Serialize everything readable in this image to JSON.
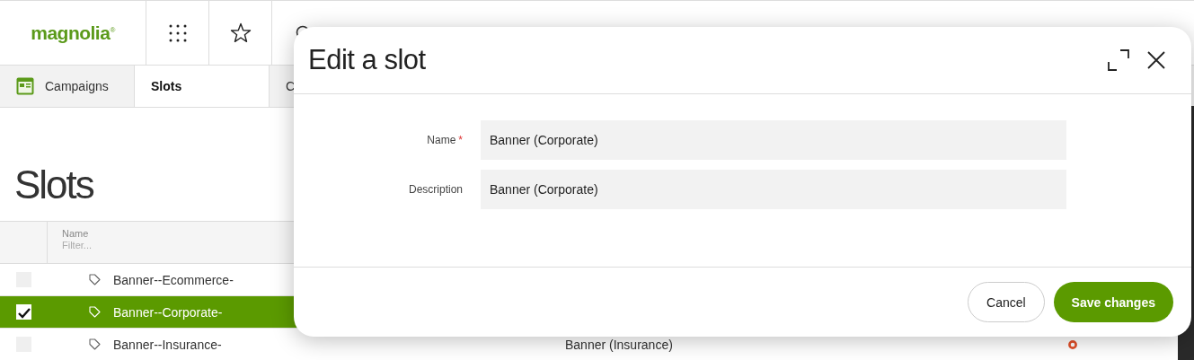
{
  "logo": "magnolia$^{®}$",
  "tabs": [
    {
      "label": "Campaigns",
      "icon": true,
      "selected": false
    },
    {
      "label": "Slots",
      "icon": false,
      "selected": true
    },
    {
      "label": "C",
      "icon": false,
      "selected": false
    }
  ],
  "page_title": "Slots",
  "table": {
    "columns": [
      {
        "label": "Name",
        "filter_placeholder": "Filter..."
      }
    ],
    "rows": [
      {
        "name": "Banner--Ecommerce-",
        "checked": false,
        "selected": false
      },
      {
        "name": "Banner--Corporate-",
        "checked": true,
        "selected": true
      },
      {
        "name": "Banner--Insurance-",
        "checked": false,
        "selected": false,
        "description": "Banner (Insurance)",
        "color": "#e2502a"
      }
    ]
  },
  "dialog": {
    "title": "Edit a slot",
    "fields": [
      {
        "label": "Name",
        "marker": "*",
        "value": "Banner (Corporate)"
      },
      {
        "label": "Description",
        "value": "Banner (Corporate)"
      }
    ],
    "buttons": [
      {
        "label": "Cancel",
        "kind": "secondary"
      },
      {
        "label": "Save changes",
        "kind": "primary"
      }
    ]
  }
}
